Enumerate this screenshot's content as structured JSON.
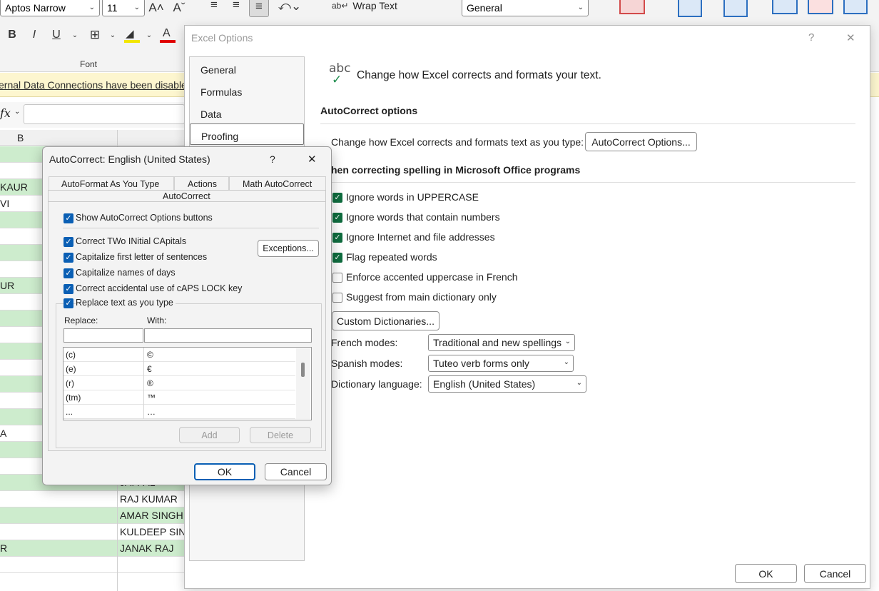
{
  "ribbon": {
    "font_name": "Aptos Narrow",
    "font_size": "11",
    "wrap_text": "Wrap Text",
    "number_format": "General",
    "font_group_label": "Font",
    "bold": "B",
    "italic": "I",
    "underline": "U",
    "grow_font": "A^",
    "shrink_font": "Aˇ",
    "fx": "fx"
  },
  "message_bar": "ernal Data Connections have been disabled",
  "sheet": {
    "col_b": "B",
    "rows": [
      {
        "a": "",
        "b": "",
        "green": true
      },
      {
        "a": "",
        "b": "",
        "green": false
      },
      {
        "a": "KAUR",
        "b": "",
        "green": true
      },
      {
        "a": "VI",
        "b": "",
        "green": false
      },
      {
        "a": "",
        "b": "",
        "green": true
      },
      {
        "a": "",
        "b": "",
        "green": false
      },
      {
        "a": "",
        "b": "",
        "green": true
      },
      {
        "a": "",
        "b": "",
        "green": false
      },
      {
        "a": "UR",
        "b": "",
        "green": true
      },
      {
        "a": "",
        "b": "",
        "green": false
      },
      {
        "a": "",
        "b": "",
        "green": true
      },
      {
        "a": "",
        "b": "",
        "green": false
      },
      {
        "a": "",
        "b": "",
        "green": true
      },
      {
        "a": "",
        "b": "",
        "green": false
      },
      {
        "a": "",
        "b": "",
        "green": true
      },
      {
        "a": "",
        "b": "",
        "green": false
      },
      {
        "a": "",
        "b": "",
        "green": true
      },
      {
        "a": "A",
        "b": "",
        "green": false
      },
      {
        "a": "",
        "b": "",
        "green": true
      },
      {
        "a": "",
        "b": "",
        "green": false
      },
      {
        "a": "",
        "b": "JAI PAL",
        "green": true
      },
      {
        "a": "",
        "b": "RAJ KUMAR",
        "green": false
      },
      {
        "a": "",
        "b": "AMAR SINGH",
        "green": true
      },
      {
        "a": "",
        "b": "KULDEEP SIN",
        "green": false
      },
      {
        "a": "R",
        "b": "JANAK RAJ",
        "green": true
      },
      {
        "a": "",
        "b": "",
        "green": false
      }
    ]
  },
  "excel_options": {
    "title": "Excel Options",
    "help": "?",
    "close": "✕",
    "nav": [
      "General",
      "Formulas",
      "Data",
      "Proofing"
    ],
    "heading_icon_text": "abc",
    "heading": "Change how Excel corrects and formats your text.",
    "autocorrect_section": "AutoCorrect options",
    "autocorrect_desc": "Change how Excel corrects and formats text as you type:",
    "autocorrect_button": "AutoCorrect Options...",
    "spelling_section": "hen correcting spelling in Microsoft Office programs",
    "checks": [
      {
        "label": "Ignore words in UPPERCASE",
        "checked": true
      },
      {
        "label": "Ignore words that contain numbers",
        "checked": true
      },
      {
        "label": "Ignore Internet and file addresses",
        "checked": true
      },
      {
        "label": "Flag repeated words",
        "checked": true
      },
      {
        "label": "Enforce accented uppercase in French",
        "checked": false
      },
      {
        "label": "Suggest from main dictionary only",
        "checked": false
      }
    ],
    "custom_dict_button": "Custom Dictionaries...",
    "french_label": "French modes:",
    "french_value": "Traditional and new spellings",
    "spanish_label": "Spanish modes:",
    "spanish_value": "Tuteo verb forms only",
    "dict_label": "Dictionary language:",
    "dict_value": "English (United States)",
    "ok": "OK",
    "cancel": "Cancel"
  },
  "autocorrect_dialog": {
    "title": "AutoCorrect: English (United States)",
    "help": "?",
    "close": "✕",
    "tabs": [
      "AutoFormat As You Type",
      "Actions",
      "Math AutoCorrect",
      "AutoCorrect"
    ],
    "show_buttons": "Show AutoCorrect Options buttons",
    "options": [
      "Correct TWo INitial CApitals",
      "Capitalize first letter of sentences",
      "Capitalize names of days",
      "Correct accidental use of cAPS LOCK key"
    ],
    "exceptions_button": "Exceptions...",
    "replace_text": "Replace text as you type",
    "replace_label": "Replace:",
    "with_label": "With:",
    "entries": [
      {
        "replace": "(c)",
        "with": "©"
      },
      {
        "replace": "(e)",
        "with": "€"
      },
      {
        "replace": "(r)",
        "with": "®"
      },
      {
        "replace": "(tm)",
        "with": "™"
      },
      {
        "replace": "...",
        "with": "…"
      }
    ],
    "add": "Add",
    "delete": "Delete",
    "ok": "OK",
    "cancel": "Cancel"
  }
}
